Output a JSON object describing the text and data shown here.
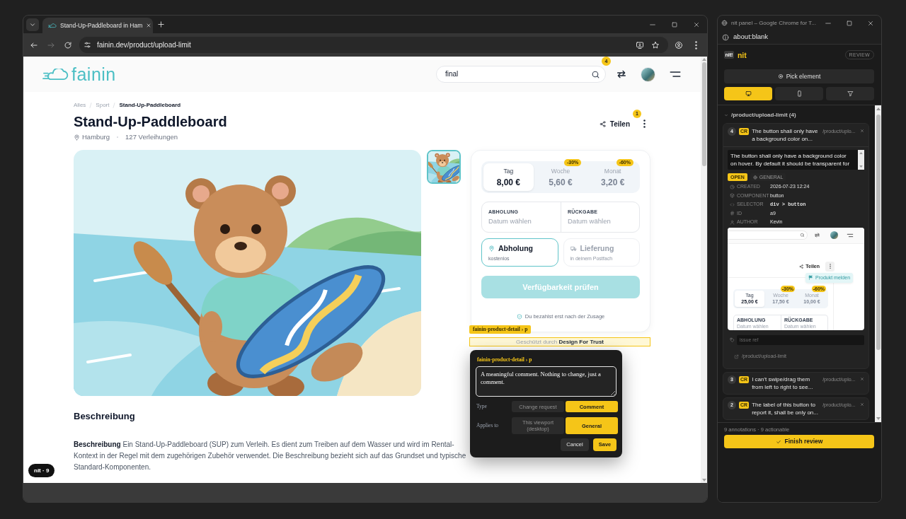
{
  "browser_window": {
    "tabs": [
      {
        "title": "Stand-Up-Paddleboard in Ham",
        "selected": true
      }
    ],
    "navigation": [
      {
        "kind": "back",
        "disabled": false
      },
      {
        "kind": "forward",
        "disabled": true
      },
      {
        "kind": "reload",
        "disabled": false
      }
    ],
    "url": "fainin.dev/product/upload-limit"
  },
  "site_header": {
    "logo": "fainin",
    "search": {
      "value": "final"
    },
    "notification_count": "4"
  },
  "breadcrumb": [
    {
      "label": "Alles",
      "current": false
    },
    {
      "label": "Sport",
      "current": false
    },
    {
      "label": "Stand-Up-Paddleboard",
      "current": true
    }
  ],
  "product": {
    "title": "Stand-Up-Paddleboard",
    "location": "Hamburg",
    "rentals": "127 Verleihungen",
    "share_label": "Teilen",
    "share_count": "1"
  },
  "gallery": {
    "thumbnails": [
      {
        "selected": true
      }
    ]
  },
  "booking": {
    "price_tabs": [
      {
        "label": "Tag",
        "price": "8,00 €",
        "selected": true
      },
      {
        "label": "Woche",
        "price": "5,60 €",
        "discount": "-30%",
        "selected": false
      },
      {
        "label": "Monat",
        "price": "3,20 €",
        "discount": "-60%",
        "selected": false
      }
    ],
    "dates": [
      {
        "label": "ABHOLUNG",
        "placeholder": "Datum wählen"
      },
      {
        "label": "RÜCKGABE",
        "placeholder": "Datum wählen"
      }
    ],
    "delivery_options": [
      {
        "kind": "pickup",
        "title": "Abholung",
        "subtitle": "kostenlos",
        "selected": true
      },
      {
        "kind": "delivery",
        "title": "Lieferung",
        "subtitle": "in deinem Postfach",
        "selected": false
      }
    ],
    "check_button": {
      "label": "Verfügbarkeit prüfen",
      "disabled": true
    },
    "note": "Du bezahlst erst nach der Zusage"
  },
  "inspector": {
    "element_label": "fainin-product-detail › p",
    "highlighted_text": "Geschützt durch **Design For Trust**"
  },
  "comment_popup": {
    "title": "fainin-product-detail › p",
    "comment": "A meaningful comment. Nothing to change, just a comment.",
    "rows": [
      {
        "label": "Type",
        "options": [
          {
            "label": "Change request",
            "selected": false
          },
          {
            "label": "Comment",
            "selected": true
          }
        ]
      },
      {
        "label": "Applies to",
        "options": [
          {
            "label": "This viewport (desktop)",
            "selected": false
          },
          {
            "label": "General",
            "selected": true
          }
        ]
      }
    ],
    "actions": [
      {
        "label": "Cancel",
        "kind": "secondary"
      },
      {
        "label": "Save",
        "kind": "primary"
      }
    ]
  },
  "description": {
    "heading": "Beschreibung",
    "text": "**Beschreibung** Ein Stand-Up-Paddleboard (SUP) zum Verleih. Es dient zum Treiben auf dem Wasser und wird im Rental-Kontext in der Regel mit dem zugehörigen Zubehör verwendet. Die Beschreibung bezieht sich auf das Grundset und typische Standard-Komponenten."
  },
  "nit_launcher": {
    "label": "nit · 9"
  },
  "panel_window": {
    "title": "nit panel – Google Chrome for T...",
    "url": "about:blank"
  },
  "nit_panel": {
    "logo_mark": "nit!",
    "brand": "nit",
    "mode": "REVIEW",
    "pick_button": "Pick element",
    "view_filters": [
      {
        "kind": "desktop",
        "selected": true
      },
      {
        "kind": "mobile",
        "selected": false
      },
      {
        "kind": "filter",
        "selected": false
      }
    ],
    "groups": [
      {
        "path": "/product/upload-limit (4)",
        "expanded": true,
        "annotations": [
          {
            "number": "4",
            "type": "CR",
            "summary": "The button shall only have a background color on...",
            "page": "/product/uplo...",
            "expanded": true,
            "body": "The button shall only have a background color on hover. By default it should be transparent for",
            "status": "OPEN",
            "scope": "GENERAL",
            "meta": [
              {
                "kind": "created",
                "label": "CREATED",
                "value": "2026-07-23 12:24"
              },
              {
                "kind": "component",
                "label": "COMPONENT",
                "value": "button"
              },
              {
                "kind": "selector",
                "label": "SELECTOR",
                "value": "div > button"
              },
              {
                "kind": "id",
                "label": "ID",
                "value": "a9"
              },
              {
                "kind": "author",
                "label": "AUTHOR",
                "value": "Kevin"
              }
            ],
            "screenshot": {
              "share_label": "Teilen",
              "menu_item": "Produkt melden",
              "price_tabs": [
                {
                  "label": "Tag",
                  "price": "25,00 €",
                  "selected": true
                },
                {
                  "label": "Woche",
                  "price": "17,50 €",
                  "discount": "-30%",
                  "selected": false
                },
                {
                  "label": "Monat",
                  "price": "10,00 €",
                  "discount": "-60%",
                  "selected": false
                }
              ],
              "dates": [
                {
                  "label": "ABHOLUNG",
                  "placeholder": "Datum wählen"
                },
                {
                  "label": "RÜCKGABE",
                  "placeholder": "Datum wählen"
                }
              ]
            },
            "issue_ref": {
              "placeholder": "issue ref"
            },
            "link": "/product/upload-limit"
          },
          {
            "number": "3",
            "type": "CR",
            "summary": "I can't swipe/drag them from left to right to see...",
            "page": "/product/uplo...",
            "expanded": false
          },
          {
            "number": "2",
            "type": "CR",
            "summary": "The label of this button to report it, shall be only on...",
            "page": "/product/uplo...",
            "expanded": false
          }
        ]
      }
    ],
    "summary": "9 annotations · 9 actionable",
    "finish_button": "Finish review"
  }
}
